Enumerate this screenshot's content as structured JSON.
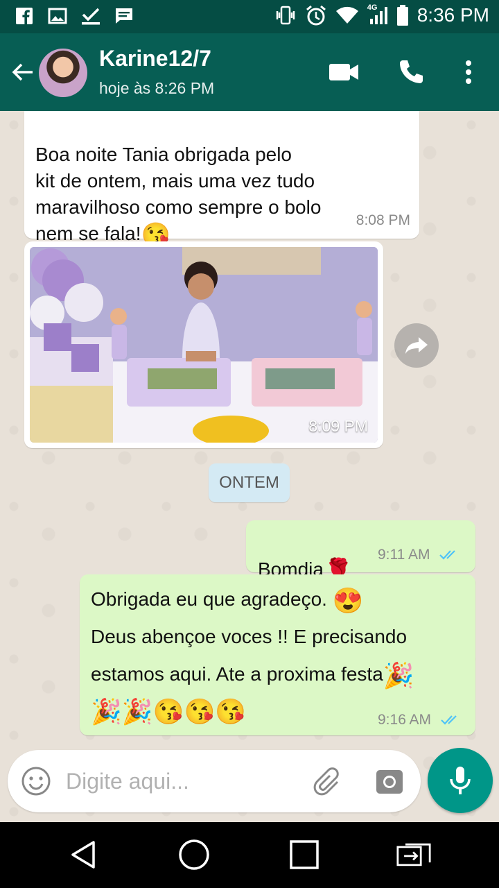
{
  "status_bar": {
    "time": "8:36 PM",
    "network": "4G",
    "left_icons": [
      "facebook-icon",
      "gallery-icon",
      "download-done-icon",
      "message-icon"
    ],
    "right_icons": [
      "vibrate-icon",
      "alarm-icon",
      "wifi-icon",
      "signal-icon",
      "battery-icon"
    ]
  },
  "header": {
    "contact_name": "Karine12/7",
    "last_seen": "hoje às 8:26 PM"
  },
  "messages": [
    {
      "direction": "in",
      "text": "Boa noite Tania obrigada  pelo\nkit de ontem, mais uma vez tudo\nmaravilhoso  como sempre o bolo\nnem se fala!",
      "emoji": "😘",
      "time": "8:08 PM"
    },
    {
      "direction": "in",
      "type": "image",
      "time": "8:09 PM"
    },
    {
      "direction": "out",
      "text": "Bomdia",
      "emoji": "🌹",
      "time": "9:11 AM"
    },
    {
      "direction": "out",
      "text_line1": "Obrigada eu que  agradeço.",
      "text_line2": "Deus abençoe voces !! E precisando",
      "text_line3": "estamos aqui. Ate a proxima festa",
      "time": "9:16 AM"
    }
  ],
  "date_divider": "ONTEM",
  "input": {
    "placeholder": "Digite aqui..."
  },
  "colors": {
    "header": "#075e54",
    "status_bar": "#054d44",
    "outgoing_bubble": "#dcf8c6",
    "incoming_bubble": "#ffffff",
    "mic_button": "#009688",
    "read_ticks": "#4fc3f7"
  }
}
